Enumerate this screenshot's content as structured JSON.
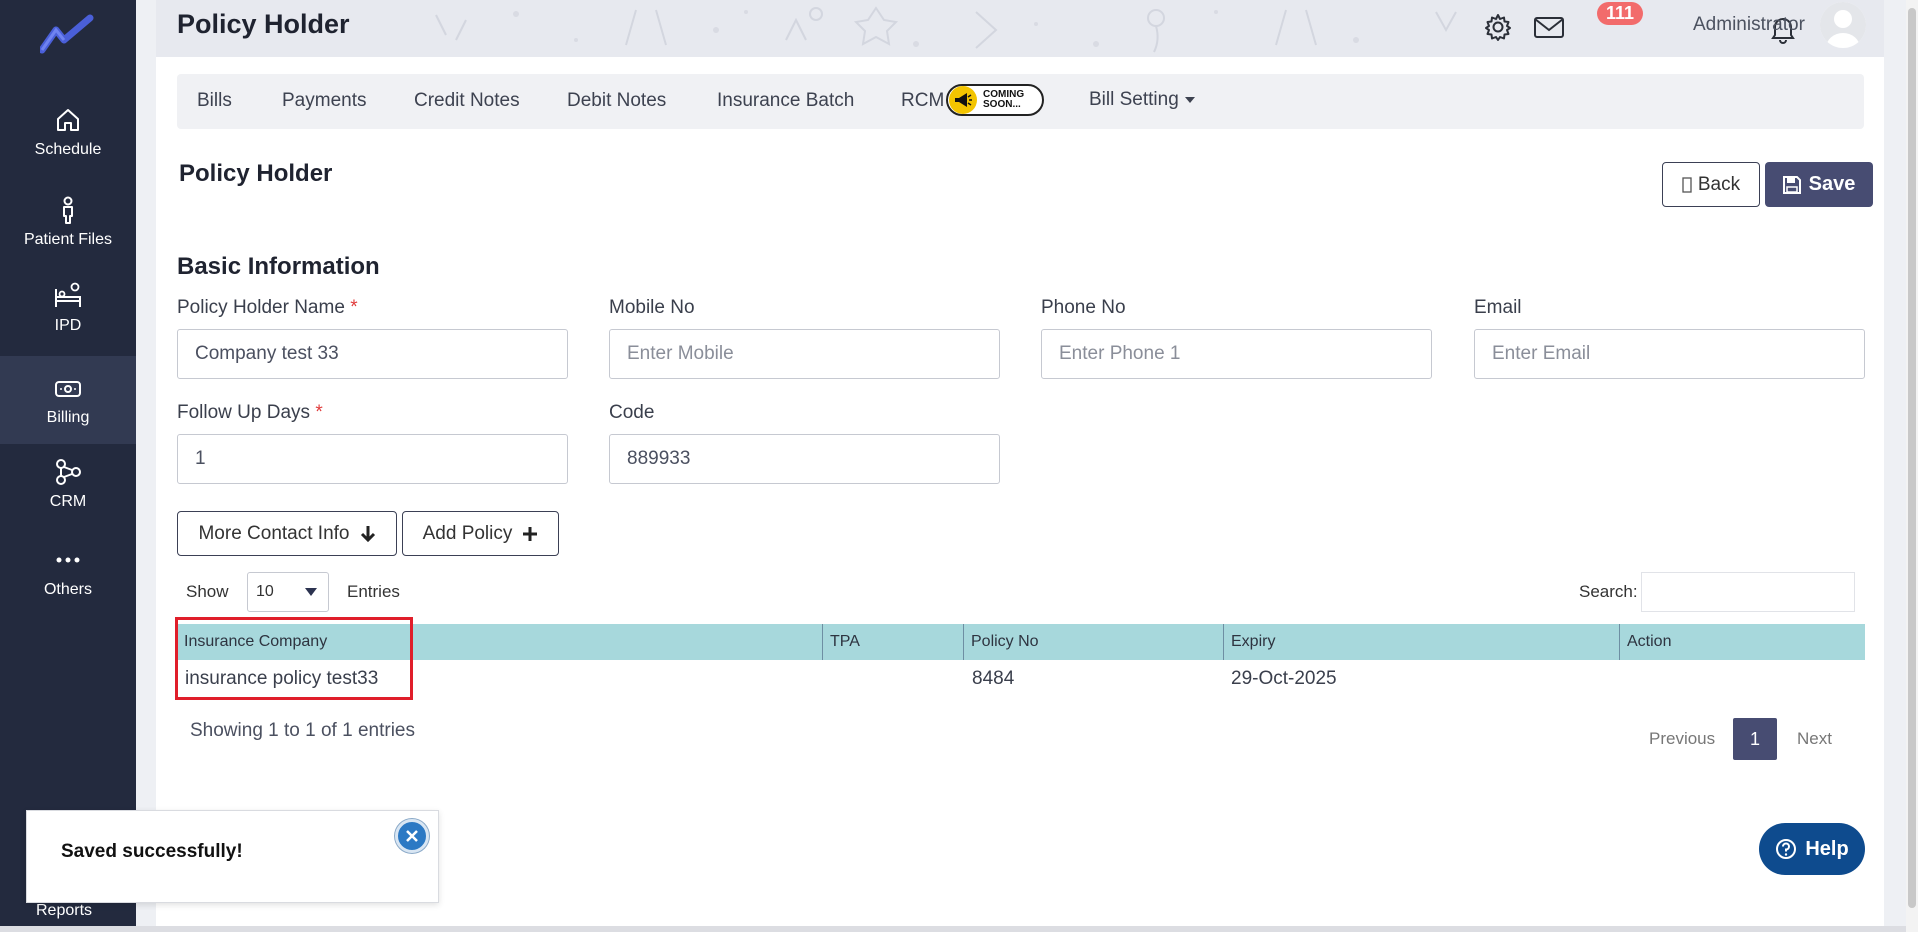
{
  "sidebar": {
    "items": [
      {
        "label": "Schedule",
        "icon": "home-icon"
      },
      {
        "label": "Patient Files",
        "icon": "person-icon"
      },
      {
        "label": "IPD",
        "icon": "bed-icon"
      },
      {
        "label": "Billing",
        "icon": "money-icon",
        "active": true
      },
      {
        "label": "CRM",
        "icon": "network-icon"
      },
      {
        "label": "Others",
        "icon": "dots-icon"
      }
    ],
    "reports_label": "Reports",
    "bg_color": "#232a3e"
  },
  "header": {
    "title": "Policy Holder",
    "notification_count": "111",
    "user_name": "Administrator"
  },
  "tabs": {
    "items": [
      "Bills",
      "Payments",
      "Credit Notes",
      "Debit Notes",
      "Insurance Batch",
      "RCM"
    ],
    "coming_soon_line1": "COMING",
    "coming_soon_line2": "SOON...",
    "bill_setting": "Bill Setting"
  },
  "page": {
    "title": "Policy Holder",
    "back_label": "Back",
    "save_label": "Save",
    "section": "Basic Information"
  },
  "form": {
    "policy_holder_name_label": "Policy Holder Name",
    "policy_holder_name_value": "Company test 33",
    "mobile_label": "Mobile No",
    "mobile_placeholder": "Enter Mobile",
    "phone_label": "Phone No",
    "phone_placeholder": "Enter Phone 1",
    "email_label": "Email",
    "email_placeholder": "Enter Email",
    "follow_up_label": "Follow Up Days",
    "follow_up_value": "1",
    "code_label": "Code",
    "code_value": "889933",
    "required_mark": "*"
  },
  "actions": {
    "more_contact": "More Contact Info",
    "add_policy": "Add Policy"
  },
  "table": {
    "show_label": "Show",
    "page_size": "10",
    "entries_label": "Entries",
    "search_label": "Search:",
    "columns": [
      "Insurance Company",
      "TPA",
      "Policy No",
      "Expiry",
      "Action"
    ],
    "rows": [
      {
        "insurance_company": "insurance policy test33",
        "tpa": "",
        "policy_no": "8484",
        "expiry": "29-Oct-2025",
        "action": ""
      }
    ],
    "header_color": "#a7d8dc",
    "showing_text": "Showing 1 to 1 of 1 entries",
    "prev_label": "Previous",
    "current_page": "1",
    "next_label": "Next"
  },
  "help_label": "Help",
  "toast": {
    "message": "Saved successfully!"
  },
  "accent_color": "#474c72"
}
